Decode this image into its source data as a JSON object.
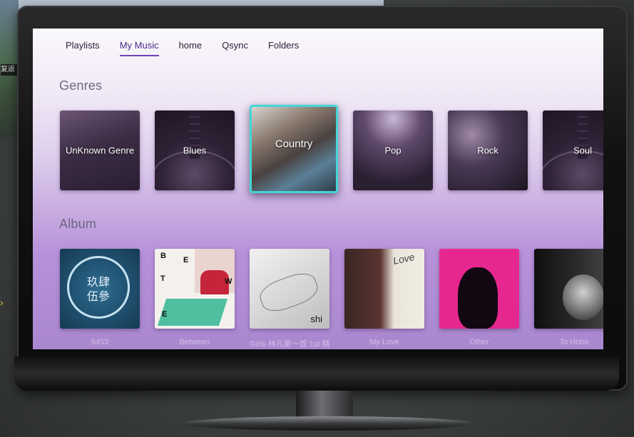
{
  "background_window": {
    "caption": "复返"
  },
  "nav": {
    "tabs": [
      {
        "label": "Playlists",
        "active": false
      },
      {
        "label": "My Music",
        "active": true
      },
      {
        "label": "home",
        "active": false
      },
      {
        "label": "Qsync",
        "active": false
      },
      {
        "label": "Folders",
        "active": false
      }
    ]
  },
  "genres": {
    "title": "Genres",
    "items": [
      {
        "label": "UnKnown Genre"
      },
      {
        "label": "Blues"
      },
      {
        "label": "Country",
        "focused": true
      },
      {
        "label": "Pop"
      },
      {
        "label": "Rock"
      },
      {
        "label": "Soul"
      }
    ]
  },
  "albums": {
    "title": "Album",
    "covers": [
      {
        "art_text": "玖肆\n伍參",
        "caption": "9453"
      },
      {
        "art_text": "BETWEEN",
        "caption": "Between"
      },
      {
        "art_text": "shi",
        "caption": "Girls 林凡第一首 1st 精"
      },
      {
        "art_text": "Love",
        "caption": "My Love"
      },
      {
        "art_text": "",
        "caption": "Other"
      },
      {
        "art_text": "",
        "caption": "To Hobo"
      }
    ]
  },
  "colors": {
    "accent": "#6a44b8",
    "focus_border": "#43d6d6"
  }
}
